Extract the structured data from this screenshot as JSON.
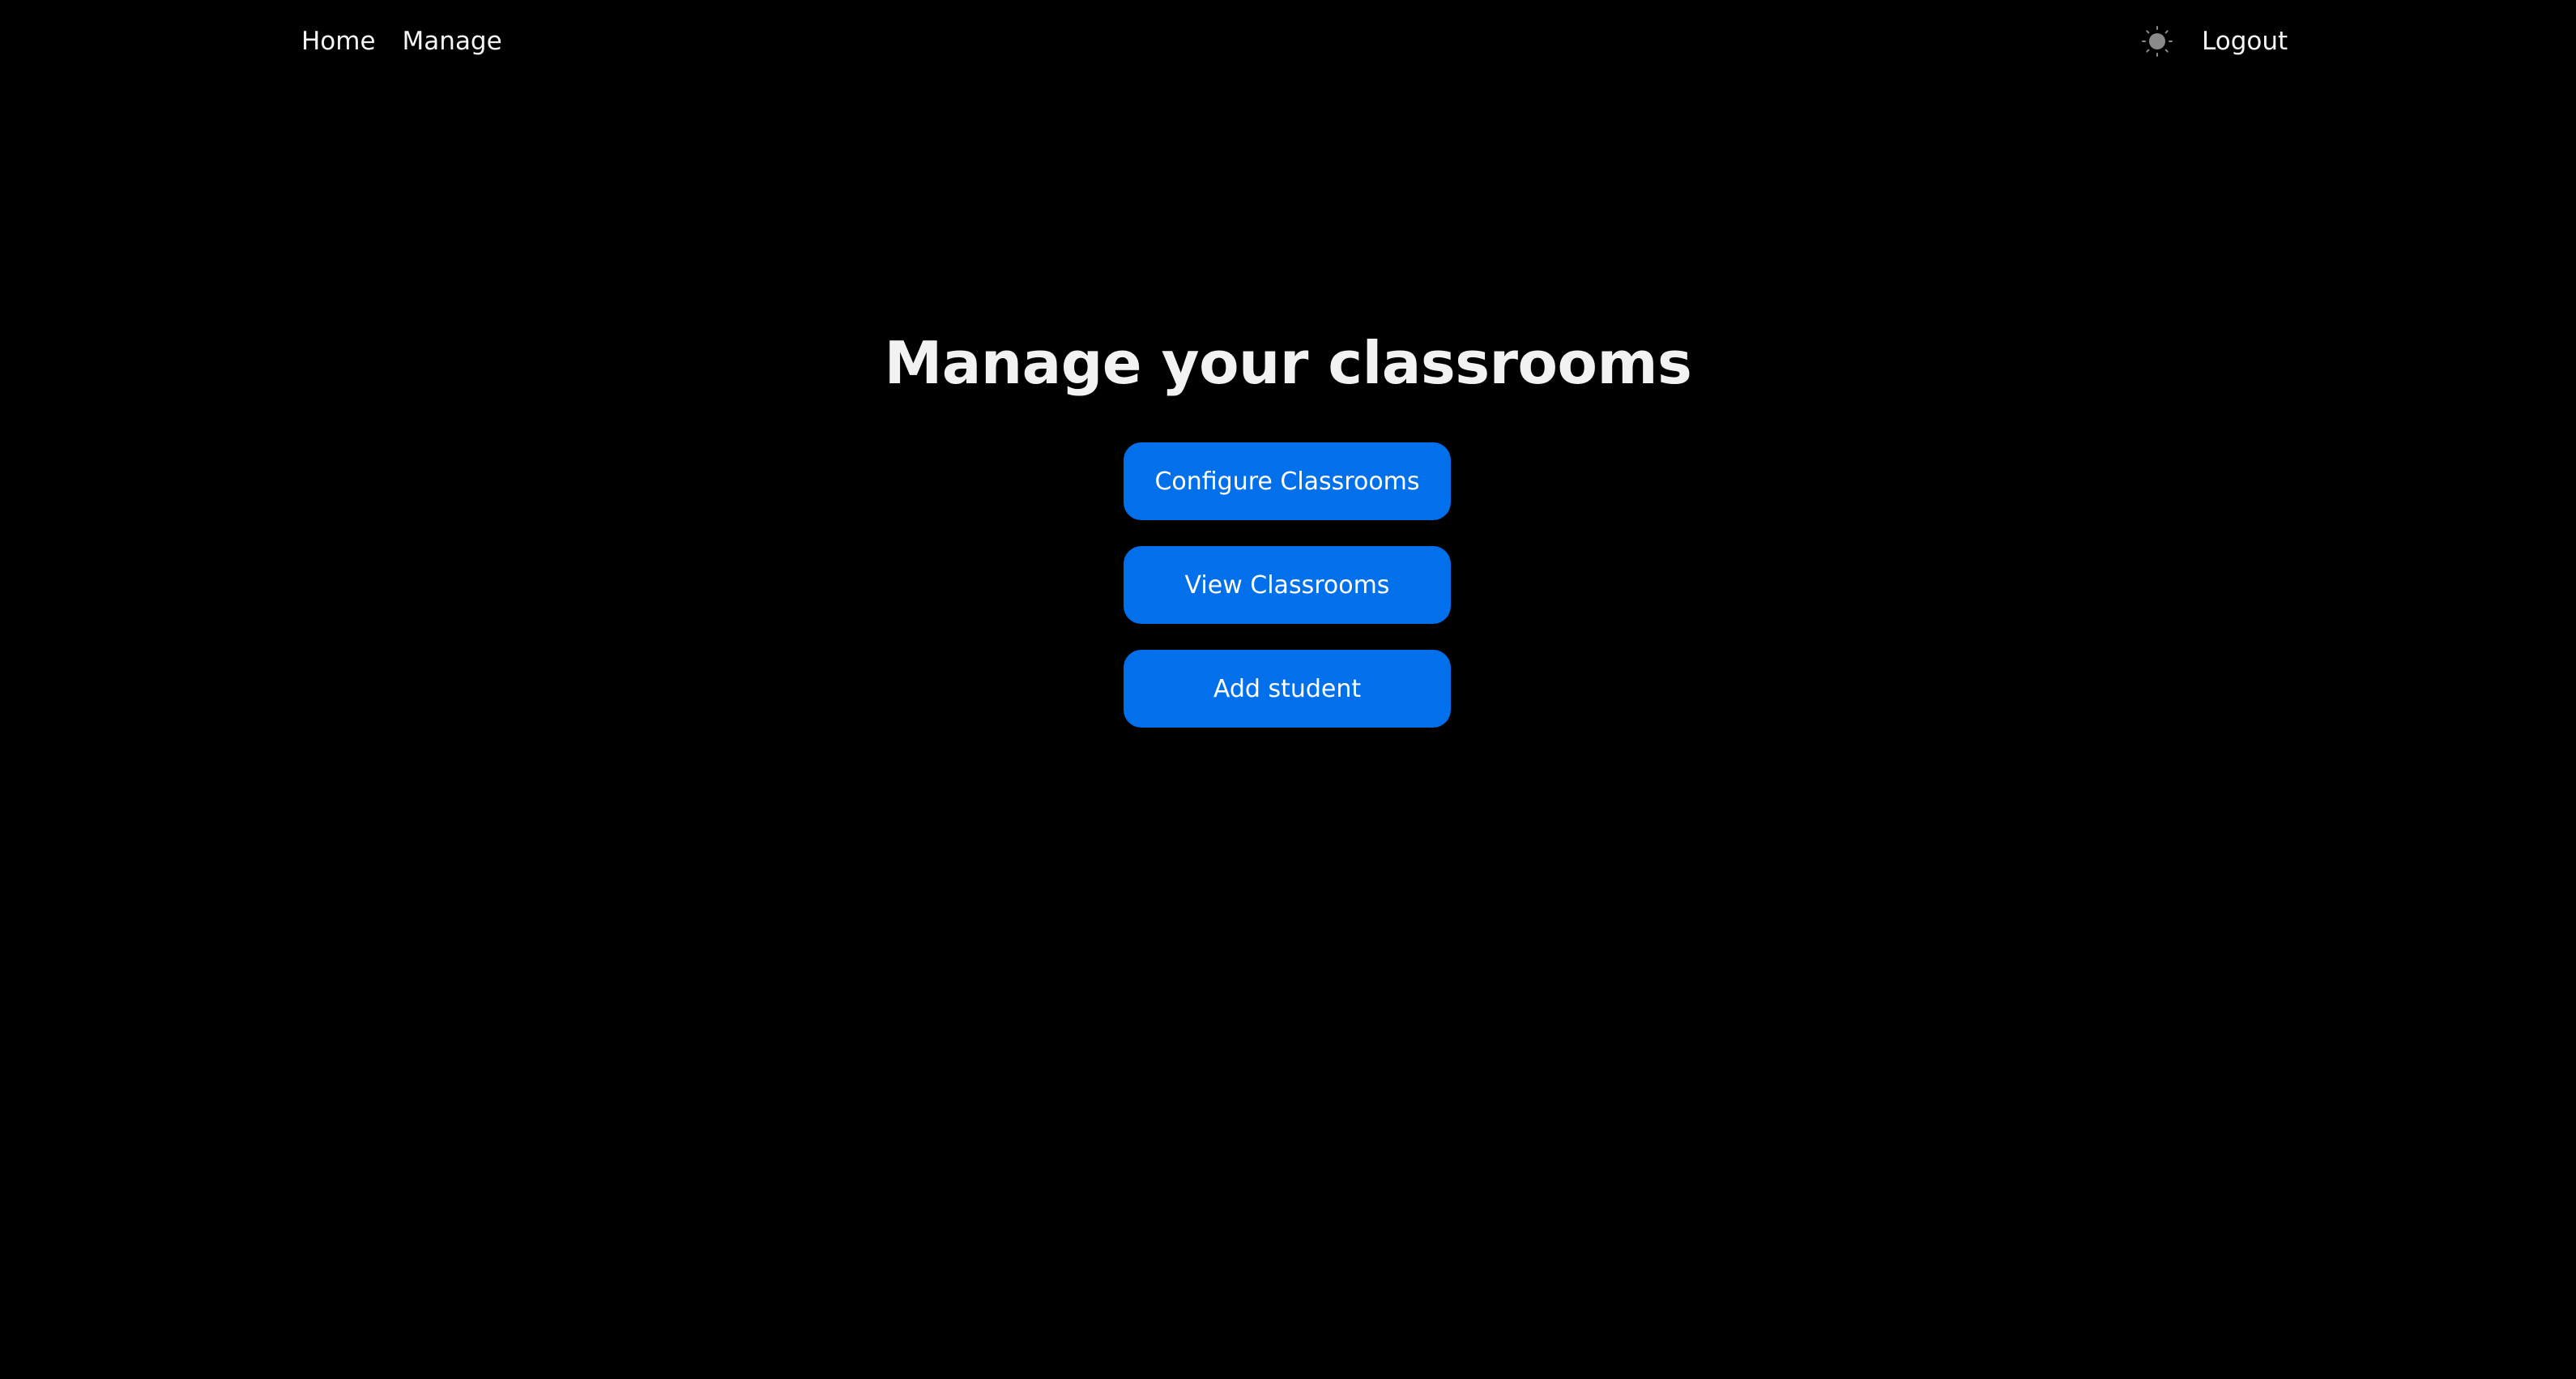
{
  "nav": {
    "links": [
      {
        "label": "Home"
      },
      {
        "label": "Manage"
      }
    ],
    "theme_toggle_icon": "sun-icon",
    "logout_label": "Logout"
  },
  "main": {
    "title": "Manage your classrooms",
    "actions": [
      {
        "label": "Configure Classrooms"
      },
      {
        "label": "View Classrooms"
      },
      {
        "label": "Add student"
      }
    ]
  },
  "colors": {
    "background": "#000000",
    "primary_button": "#0270ea",
    "text": "#f2f2f2"
  }
}
